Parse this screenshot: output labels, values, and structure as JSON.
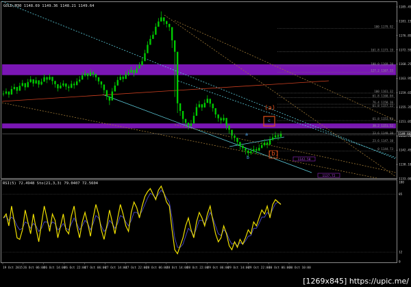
{
  "header": {
    "main_info": "GOLD,M30  1148.69 1149.36 1148.21 1149.64",
    "osc_info": "RSI(5) 72.4948  Sto(21,3,3) 79.0407 72.5604"
  },
  "watermark": "[1269x845] https://upic.me/",
  "colors": {
    "background": "#000000",
    "candles": "#00cc00",
    "zones": "#7a16b4",
    "channel": "#5fd0e0",
    "fan": "#a07a36",
    "wave_red": "#e0501c",
    "wave_blue": "#4fb2ff",
    "rsi": "#f0e000",
    "stoch": "#4a4ad0"
  },
  "chart_data": [
    {
      "type": "line",
      "name": "GOLD,M30 price",
      "ylim": [
        1137.1,
        1187.3
      ],
      "y_ticks": [
        "1185.45",
        "1181.15",
        "1176.85",
        "1172.55",
        "1168.25",
        "1163.95",
        "1159.65",
        "1155.35",
        "1151.05",
        "1146.75",
        "1142.45",
        "1138.10",
        "1133.00"
      ],
      "x_labels": [
        "19 Oct 2015",
        "26 Oct 06:00",
        "26 Oct 14:00",
        "26 Oct 22:00",
        "27 Oct 06:00",
        "27 Oct 14:00",
        "27 Oct 22:00",
        "28 Oct 06:00",
        "28 Oct 14:00",
        "28 Oct 22:00",
        "29 Oct 06:00",
        "29 Oct 14:00",
        "29 Oct 22:00",
        "30 Oct 06:00",
        "30 Oct 10:00"
      ],
      "last_price": "1149.64",
      "series": [
        {
          "values": [
            1161.2,
            1161.8,
            1160.9,
            1162.5,
            1163.1,
            1162.0,
            1163.4,
            1164.2,
            1163.0,
            1164.5,
            1165.3,
            1164.1,
            1165.0,
            1163.8,
            1164.6,
            1165.9,
            1165.2,
            1166.0,
            1164.8,
            1163.9,
            1162.7,
            1163.5,
            1164.1,
            1163.2,
            1162.8,
            1164.0,
            1163.6,
            1164.7,
            1165.2,
            1166.4,
            1167.0,
            1166.2,
            1167.3,
            1166.8,
            1165.9,
            1164.7,
            1163.8,
            1162.2,
            1160.4,
            1159.2,
            1161.8,
            1163.5,
            1165.1,
            1166.0,
            1165.4,
            1166.7,
            1167.2,
            1168.0,
            1167.1,
            1168.4,
            1169.3,
            1170.5,
            1172.8,
            1175.2,
            1176.9,
            1178.1,
            1180.4,
            1181.9,
            1183.1,
            1182.0,
            1181.2,
            1180.3,
            1176.5,
            1173.2,
            1158.4,
            1156.2,
            1153.9,
            1152.8,
            1151.9,
            1152.6,
            1154.8,
            1157.3,
            1158.1,
            1157.2,
            1158.5,
            1159.7,
            1158.3,
            1157.0,
            1155.2,
            1154.1,
            1153.5,
            1154.2,
            1152.0,
            1150.8,
            1149.1,
            1148.5,
            1147.3,
            1146.2,
            1145.5,
            1144.8,
            1144.1,
            1144.6,
            1145.2,
            1144.8,
            1145.6,
            1146.4,
            1147.1,
            1146.5,
            1147.9,
            1148.6,
            1149.2,
            1148.8,
            1149.64
          ],
          "min": [
            1160.4,
            1160.9,
            1160.0,
            1161.4,
            1162.2,
            1161.1,
            1162.5,
            1163.2,
            1162.1,
            1163.5,
            1164.3,
            1163.2,
            1164.0,
            1162.9,
            1163.6,
            1164.9,
            1164.2,
            1165.0,
            1163.8,
            1162.9,
            1161.8,
            1162.6,
            1163.1,
            1162.3,
            1161.8,
            1163.0,
            1162.6,
            1163.7,
            1164.3,
            1165.3,
            1166.0,
            1165.2,
            1166.3,
            1165.9,
            1164.9,
            1163.8,
            1162.8,
            1161.2,
            1159.4,
            1157.9,
            1160.8,
            1162.5,
            1164.2,
            1165.0,
            1164.5,
            1165.7,
            1166.2,
            1167.1,
            1166.1,
            1167.4,
            1168.3,
            1169.5,
            1171.8,
            1174.2,
            1175.9,
            1177.0,
            1179.3,
            1180.9,
            1182.1,
            1181.0,
            1180.2,
            1179.2,
            1174.3,
            1160.2,
            1155.6,
            1154.8,
            1152.7,
            1151.8,
            1150.9,
            1151.6,
            1153.8,
            1156.3,
            1157.0,
            1156.2,
            1157.4,
            1158.7,
            1157.3,
            1156.0,
            1154.2,
            1153.1,
            1152.4,
            1153.1,
            1150.8,
            1149.6,
            1148.0,
            1147.4,
            1146.2,
            1145.1,
            1144.4,
            1143.7,
            1143.0,
            1143.6,
            1144.2,
            1143.8,
            1144.6,
            1145.4,
            1146.0,
            1145.5,
            1146.9,
            1147.6,
            1148.2,
            1147.8,
            1148.5
          ],
          "max": [
            1162.0,
            1162.7,
            1161.8,
            1163.4,
            1164.0,
            1162.9,
            1164.3,
            1165.1,
            1164.0,
            1165.4,
            1166.2,
            1165.0,
            1165.9,
            1164.8,
            1165.5,
            1166.8,
            1166.1,
            1166.9,
            1165.8,
            1164.9,
            1163.7,
            1164.4,
            1165.0,
            1164.1,
            1163.8,
            1164.9,
            1164.6,
            1165.6,
            1166.2,
            1167.3,
            1167.9,
            1167.1,
            1168.2,
            1167.7,
            1166.9,
            1165.7,
            1164.7,
            1163.2,
            1161.4,
            1160.2,
            1162.8,
            1164.5,
            1166.0,
            1166.9,
            1166.4,
            1167.6,
            1168.1,
            1168.9,
            1168.0,
            1169.3,
            1170.2,
            1171.5,
            1173.8,
            1176.2,
            1177.9,
            1179.1,
            1181.4,
            1182.9,
            1184.8,
            1183.0,
            1182.2,
            1181.3,
            1177.5,
            1174.2,
            1159.4,
            1157.2,
            1154.9,
            1153.8,
            1152.9,
            1153.6,
            1155.8,
            1158.3,
            1159.1,
            1158.2,
            1159.5,
            1160.7,
            1159.3,
            1158.0,
            1156.2,
            1155.1,
            1154.5,
            1155.2,
            1153.0,
            1151.8,
            1150.1,
            1149.5,
            1148.3,
            1147.2,
            1146.5,
            1145.8,
            1145.1,
            1145.6,
            1146.2,
            1145.8,
            1146.6,
            1147.4,
            1148.1,
            1147.5,
            1148.9,
            1149.6,
            1150.2,
            1149.8,
            1150.4
          ]
        }
      ],
      "zones": [
        {
          "from": 1166.5,
          "to": 1169.6
        },
        {
          "from": 1151.2,
          "to": 1152.6
        }
      ],
      "fib_levels": [
        {
          "label": "100  1179.92",
          "value": 1179.92
        },
        {
          "label": "161.8  1173.19",
          "value": 1173.19
        },
        {
          "label": "100.0  1169.20",
          "value": 1169.2
        },
        {
          "label": "127.2  1167.33",
          "value": 1167.33
        },
        {
          "label": "100  1161.32",
          "value": 1161.32
        },
        {
          "label": "61.8  1160.04",
          "value": 1160.04
        },
        {
          "label": "76.4  1158.16",
          "value": 1158.16
        },
        {
          "label": "61.8  1157.22",
          "value": 1157.22
        },
        {
          "label": "61.8  1153.43",
          "value": 1153.43
        },
        {
          "label": "38.2  1151.52",
          "value": 1151.52
        },
        {
          "label": "23.6  1149.30",
          "value": 1149.3
        },
        {
          "label": "23.6  1147.10",
          "value": 1147.1
        },
        {
          "label": "0  1144.73",
          "value": 1144.73
        }
      ],
      "wave_labels": [
        {
          "text": "(a)",
          "color": "#e0501c"
        },
        {
          "text": "c",
          "color": "#4fb2ff"
        },
        {
          "text": "a",
          "color": "#4fb2ff"
        },
        {
          "text": "b",
          "color": "#4fb2ff"
        },
        {
          "text": "(b)",
          "color": "#e0501c"
        }
      ],
      "price_tags": [
        "1142.58",
        "1137.72"
      ]
    },
    {
      "type": "line",
      "name": "RSI(5) / Sto(21,3,3)",
      "ylim": [
        0,
        100
      ],
      "y_ticks": [
        "100",
        "85",
        "12",
        "0"
      ],
      "series": [
        {
          "name": "RSI(5)",
          "values": [
            55,
            60,
            45,
            70,
            50,
            30,
            28,
            40,
            65,
            50,
            35,
            60,
            42,
            25,
            48,
            70,
            55,
            38,
            60,
            52,
            30,
            45,
            60,
            40,
            35,
            58,
            70,
            45,
            30,
            50,
            62,
            48,
            32,
            55,
            72,
            60,
            40,
            28,
            45,
            65,
            50,
            35,
            55,
            72,
            60,
            45,
            38,
            62,
            75,
            68,
            55,
            70,
            82,
            88,
            92,
            85,
            78,
            90,
            95,
            86,
            75,
            70,
            40,
            15,
            10,
            20,
            30,
            45,
            55,
            40,
            30,
            50,
            62,
            55,
            45,
            60,
            70,
            52,
            35,
            25,
            30,
            45,
            35,
            20,
            15,
            25,
            18,
            28,
            22,
            30,
            40,
            35,
            50,
            45,
            55,
            65,
            60,
            70,
            55,
            72,
            78,
            75,
            72
          ]
        },
        {
          "name": "Sto(21,3,3)",
          "values": [
            55,
            57,
            52,
            56,
            53,
            45,
            40,
            42,
            50,
            48,
            42,
            48,
            45,
            38,
            42,
            50,
            50,
            44,
            50,
            48,
            40,
            43,
            48,
            42,
            40,
            48,
            55,
            48,
            40,
            45,
            52,
            48,
            40,
            48,
            58,
            55,
            45,
            38,
            42,
            52,
            48,
            42,
            48,
            58,
            56,
            50,
            45,
            52,
            62,
            62,
            58,
            64,
            72,
            80,
            86,
            84,
            80,
            85,
            90,
            86,
            80,
            75,
            55,
            30,
            18,
            18,
            22,
            32,
            42,
            38,
            33,
            42,
            52,
            52,
            48,
            54,
            62,
            55,
            45,
            35,
            33,
            40,
            37,
            28,
            22,
            24,
            20,
            24,
            22,
            26,
            32,
            33,
            42,
            42,
            48,
            56,
            56,
            62,
            58,
            66,
            73,
            75,
            72.56
          ]
        }
      ]
    }
  ]
}
